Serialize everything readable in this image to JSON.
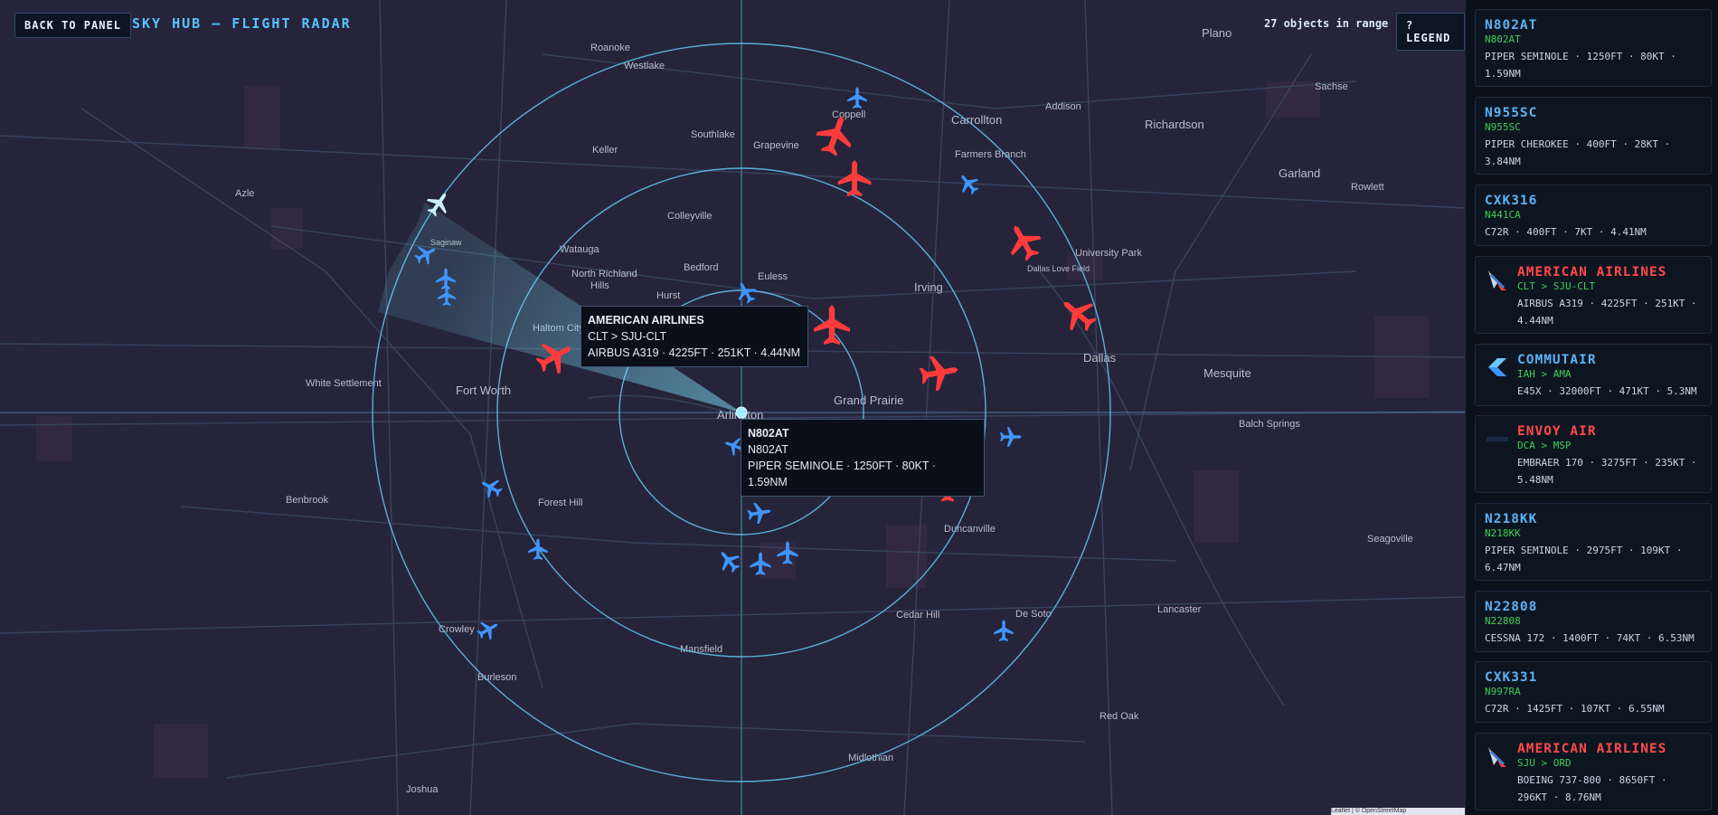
{
  "header": {
    "back_label": "BACK TO PANEL",
    "title": "SKY HUB — FLIGHT RADAR",
    "range_text": "27 objects in range",
    "legend_label": "? LEGEND"
  },
  "map": {
    "attribution": "Leaflet | © OpenStreetMap",
    "place_labels": [
      "Roanoke",
      "Westlake",
      "Southlake",
      "Keller",
      "Grapevine",
      "Coppell",
      "Carrollton",
      "Farmers Branch",
      "Addison",
      "Richardson",
      "Plano",
      "Garland",
      "Sachse",
      "Rowlett",
      "Azle",
      "Colleyville",
      "Watauga",
      "North Richland Hills",
      "Bedford",
      "Euless",
      "Hurst",
      "Irving",
      "University Park",
      "Dallas",
      "Mesquite",
      "Haltom City",
      "Fort Worth",
      "White Settlement",
      "Arlington",
      "Grand Prairie",
      "Balch Springs",
      "Benbrook",
      "Forest Hill",
      "Duncanville",
      "Cedar Hill",
      "De Soto",
      "Lancaster",
      "Seagoville",
      "Crowley",
      "Burleson",
      "Mansfield",
      "Midlothian",
      "Red Oak",
      "Joshua",
      "Saginaw",
      "Dallas Love Field"
    ],
    "colors": {
      "commercial": "#ff3b3b",
      "general_aviation": "#3f95ff",
      "selected": "#bfeaff",
      "rings": "#5fbfe6"
    }
  },
  "popups": {
    "aa": {
      "title": "AMERICAN AIRLINES",
      "route": "CLT > SJU-CLT",
      "detail": "AIRBUS A319 · 4225FT · 251KT · 4.44NM"
    },
    "n802": {
      "title": "N802AT",
      "reg": "N802AT",
      "detail": "PIPER SEMINOLE · 1250FT · 80KT · 1.59NM"
    }
  },
  "flights": [
    {
      "callsign": "N802AT",
      "reg": "N802AT",
      "details": "PIPER SEMINOLE · 1250FT · 80KT · 1.59NM",
      "color": "blue",
      "logo": ""
    },
    {
      "callsign": "N955SC",
      "reg": "N955SC",
      "details": "PIPER CHEROKEE · 400FT · 28KT · 3.84NM",
      "color": "blue",
      "logo": ""
    },
    {
      "callsign": "CXK316",
      "reg": "N441CA",
      "details": "C72R · 400FT · 7KT · 4.41NM",
      "color": "blue",
      "logo": ""
    },
    {
      "callsign": "AMERICAN AIRLINES",
      "reg": "CLT > SJU-CLT",
      "details": "AIRBUS A319 · 4225FT · 251KT · 4.44NM",
      "color": "red",
      "logo": "american-airlines-logo"
    },
    {
      "callsign": "COMMUTAIR",
      "reg": "IAH > AMA",
      "details": "E45X · 32000FT · 471KT · 5.3NM",
      "color": "blue",
      "logo": "commutair-logo"
    },
    {
      "callsign": "ENVOY AIR",
      "reg": "DCA > MSP",
      "details": "EMBRAER 170 · 3275FT · 235KT · 5.48NM",
      "color": "red",
      "logo": "envoy-air-logo"
    },
    {
      "callsign": "N218KK",
      "reg": "N218KK",
      "details": "PIPER SEMINOLE · 2975FT · 109KT · 6.47NM",
      "color": "blue",
      "logo": ""
    },
    {
      "callsign": "N22808",
      "reg": "N22808",
      "details": "CESSNA 172 · 1400FT · 74KT · 6.53NM",
      "color": "blue",
      "logo": ""
    },
    {
      "callsign": "CXK331",
      "reg": "N997RA",
      "details": "C72R · 1425FT · 107KT · 6.55NM",
      "color": "blue",
      "logo": ""
    },
    {
      "callsign": "AMERICAN AIRLINES",
      "reg": "SJU > ORD",
      "details": "BOEING 737-800 · 8650FT · 296KT · 8.76NM",
      "color": "red",
      "logo": "american-airlines-logo"
    }
  ]
}
